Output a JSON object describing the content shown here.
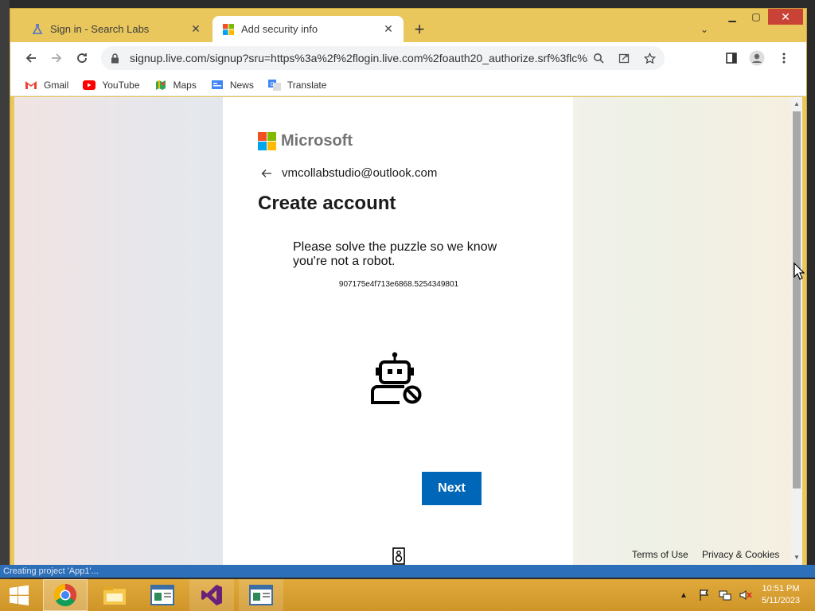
{
  "browser": {
    "tabs": [
      {
        "title": "Sign in - Search Labs",
        "icon": "flask-icon",
        "active": false
      },
      {
        "title": "Add security info",
        "icon": "microsoft-icon",
        "active": true
      }
    ],
    "new_tab_icon": "plus-icon",
    "url": "signup.live.com/signup?sru=https%3a%2f%2flogin.live.com%2foauth20_authorize.srf%3flc%3d1033%..."
  },
  "bookmarks": [
    {
      "label": "Gmail",
      "icon": "gmail-icon"
    },
    {
      "label": "YouTube",
      "icon": "youtube-icon"
    },
    {
      "label": "Maps",
      "icon": "maps-icon"
    },
    {
      "label": "News",
      "icon": "news-icon"
    },
    {
      "label": "Translate",
      "icon": "translate-icon"
    }
  ],
  "signup": {
    "brand": "Microsoft",
    "email": "vmcollabstudio@outlook.com",
    "title": "Create account",
    "puzzle_prompt": "Please solve the puzzle so we know you're not a robot.",
    "session_id": "907175e4f713e6868.5254349801",
    "next_label": "Next",
    "footer": {
      "terms": "Terms of Use",
      "privacy": "Privacy & Cookies"
    }
  },
  "status_line": "Creating project 'App1'...",
  "taskbar": {
    "time": "10:51 PM",
    "date": "5/11/2023"
  },
  "colors": {
    "ms_red": "#f25022",
    "ms_green": "#7fba00",
    "ms_blue": "#00a4ef",
    "ms_yellow": "#ffb900",
    "button_blue": "#0067b8",
    "window_frame": "#e9c75c"
  }
}
